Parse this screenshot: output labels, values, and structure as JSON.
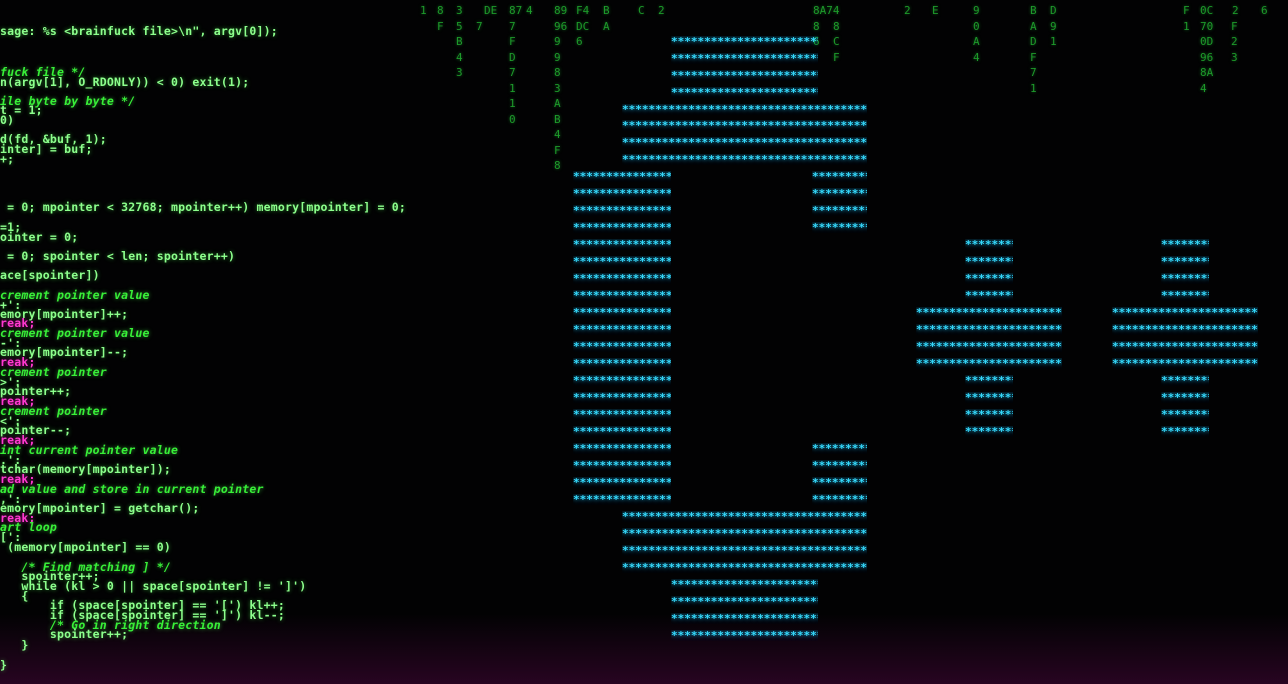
{
  "code": {
    "lines": [
      {
        "text": "sage: %s <brainfuck file>\\n\", argv[0]);",
        "style": "code"
      },
      {
        "text": "fuck file */",
        "style": "comment"
      },
      {
        "text": "n(argv[1], O_RDONLY)) < 0) exit(1);",
        "style": "code"
      },
      {
        "text": "ile byte by byte */",
        "style": "comment"
      },
      {
        "text": "t = 1;",
        "style": "code"
      },
      {
        "text": "0)",
        "style": "code"
      },
      {
        "text": "d(fd, &buf, 1);",
        "style": "code"
      },
      {
        "text": "inter] = buf;",
        "style": "code"
      },
      {
        "text": "+;",
        "style": "code"
      },
      {
        "text": " = 0; mpointer < 32768; mpointer++) memory[mpointer] = 0;",
        "style": "code"
      },
      {
        "text": "=1;",
        "style": "code"
      },
      {
        "text": "ointer = 0;",
        "style": "code"
      },
      {
        "text": " = 0; spointer < len; spointer++)",
        "style": "code"
      },
      {
        "text": "ace[spointer])",
        "style": "code"
      },
      {
        "text": "crement pointer value",
        "style": "comment"
      },
      {
        "text": "+':",
        "style": "code"
      },
      {
        "text": "emory[mpointer]++;",
        "style": "code"
      },
      {
        "text": "reak;",
        "style": "kw"
      },
      {
        "text": "crement pointer value",
        "style": "comment"
      },
      {
        "text": "-':",
        "style": "code"
      },
      {
        "text": "emory[mpointer]--;",
        "style": "code"
      },
      {
        "text": "reak;",
        "style": "kw"
      },
      {
        "text": "crement pointer",
        "style": "comment"
      },
      {
        "text": ">':",
        "style": "code"
      },
      {
        "text": "pointer++;",
        "style": "code"
      },
      {
        "text": "reak;",
        "style": "kw"
      },
      {
        "text": "crement pointer",
        "style": "comment"
      },
      {
        "text": "<':",
        "style": "code"
      },
      {
        "text": "pointer--;",
        "style": "code"
      },
      {
        "text": "reak;",
        "style": "kw"
      },
      {
        "text": "int current pointer value",
        "style": "comment"
      },
      {
        "text": ".':",
        "style": "code"
      },
      {
        "text": "tchar(memory[mpointer]);",
        "style": "code"
      },
      {
        "text": "reak;",
        "style": "kw"
      },
      {
        "text": "ad value and store in current pointer",
        "style": "comment"
      },
      {
        "text": ",':",
        "style": "code"
      },
      {
        "text": "emory[mpointer] = getchar();",
        "style": "code"
      },
      {
        "text": "reak;",
        "style": "kw"
      },
      {
        "text": "art loop",
        "style": "comment"
      },
      {
        "text": "[':",
        "style": "code"
      },
      {
        "text": " (memory[mpointer] == 0)",
        "style": "code"
      },
      {
        "text": "   /* Find matching ] */",
        "style": "comment"
      },
      {
        "text": "   spointer++;",
        "style": "code"
      },
      {
        "text": "   while (kl > 0 || space[spointer] != ']')",
        "style": "code"
      },
      {
        "text": "   {",
        "style": "code"
      },
      {
        "text": "       if (space[spointer] == '[') kl++;",
        "style": "code"
      },
      {
        "text": "       if (space[spointer] == ']') kl--;",
        "style": "code"
      },
      {
        "text": "       /* Go in right direction",
        "style": "comment"
      },
      {
        "text": "       spointer++;",
        "style": "code"
      },
      {
        "text": "   }",
        "style": "code"
      },
      {
        "text": "}",
        "style": "code"
      }
    ]
  },
  "hex_rain": [
    {
      "lines": [
        "1"
      ]
    },
    {
      "lines": [
        "8",
        "F"
      ]
    },
    {
      "lines": [
        "3",
        "5",
        "B",
        "4",
        "3"
      ]
    },
    {
      "lines": [
        "",
        "7"
      ]
    },
    {
      "lines": [
        "DE"
      ]
    },
    {
      "lines": [
        "87",
        "7",
        "F",
        "D",
        "7",
        "1",
        "1",
        "0"
      ]
    },
    {
      "lines": [
        "4"
      ]
    },
    {
      "lines": [
        "89",
        "96",
        "9",
        "9",
        "8",
        "3",
        "A",
        "B",
        "4",
        "F",
        "8"
      ]
    },
    {
      "lines": [
        "F4",
        "DC",
        "6"
      ]
    },
    {
      "lines": [
        "B",
        "A"
      ]
    },
    {
      "lines": [
        "C"
      ]
    },
    {
      "lines": [
        "2"
      ]
    },
    {
      "lines": [
        "8A74",
        "8",
        "6"
      ]
    },
    {
      "lines": [
        "",
        "8",
        "C",
        "F"
      ]
    },
    {
      "lines": [
        "2"
      ]
    },
    {
      "lines": [
        "E"
      ]
    },
    {
      "lines": [
        "9",
        "0",
        "A",
        "4"
      ]
    },
    {
      "lines": [
        "B",
        "A",
        "D",
        "F",
        "7",
        "1"
      ]
    },
    {
      "lines": [
        "D",
        "9",
        "1"
      ]
    },
    {
      "lines": [
        "F",
        "1"
      ]
    },
    {
      "lines": [
        "0C",
        "70",
        "0D",
        "96",
        "8A",
        "4"
      ]
    },
    {
      "lines": [
        "",
        "F",
        "2",
        "3"
      ]
    },
    {
      "lines": [
        "2"
      ]
    },
    {
      "lines": [
        "6"
      ]
    }
  ],
  "logo": {
    "glyph": "*",
    "color": "#36dcff",
    "letters": [
      "C",
      "+",
      "+"
    ]
  }
}
